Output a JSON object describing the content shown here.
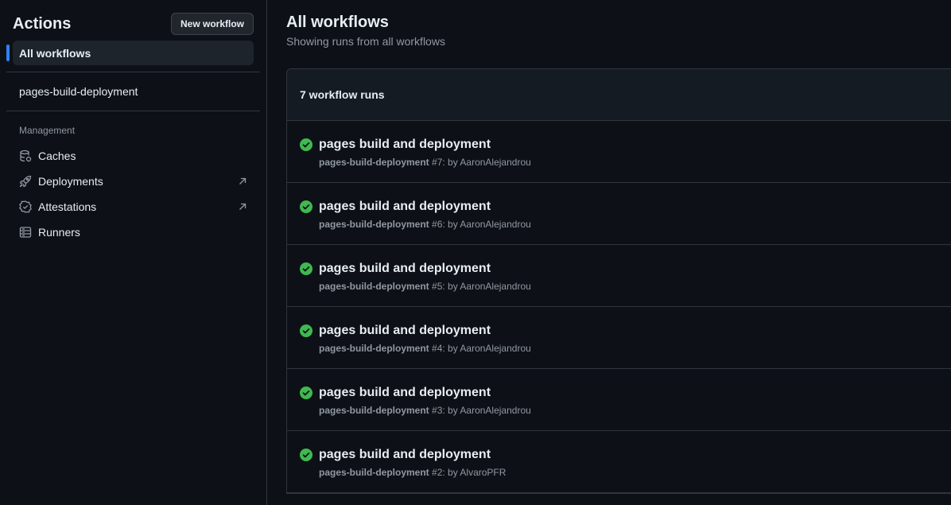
{
  "sidebar": {
    "title": "Actions",
    "new_workflow_label": "New workflow",
    "all_workflows_label": "All workflows",
    "workflows": [
      "pages-build-deployment"
    ],
    "management_label": "Management",
    "management_items": [
      {
        "label": "Caches",
        "icon": "database-icon",
        "external": false
      },
      {
        "label": "Deployments",
        "icon": "rocket-icon",
        "external": true
      },
      {
        "label": "Attestations",
        "icon": "verified-shield-icon",
        "external": true
      },
      {
        "label": "Runners",
        "icon": "server-icon",
        "external": false
      }
    ]
  },
  "main": {
    "title": "All workflows",
    "subtitle": "Showing runs from all workflows",
    "runs_count_label": "7 workflow runs",
    "runs": [
      {
        "title": "pages build and deployment",
        "workflow": "pages-build-deployment",
        "run_number": "#7",
        "by": ": by AaronAlejandrou",
        "status": "success"
      },
      {
        "title": "pages build and deployment",
        "workflow": "pages-build-deployment",
        "run_number": "#6",
        "by": ": by AaronAlejandrou",
        "status": "success"
      },
      {
        "title": "pages build and deployment",
        "workflow": "pages-build-deployment",
        "run_number": "#5",
        "by": ": by AaronAlejandrou",
        "status": "success"
      },
      {
        "title": "pages build and deployment",
        "workflow": "pages-build-deployment",
        "run_number": "#4",
        "by": ": by AaronAlejandrou",
        "status": "success"
      },
      {
        "title": "pages build and deployment",
        "workflow": "pages-build-deployment",
        "run_number": "#3",
        "by": ": by AaronAlejandrou",
        "status": "success"
      },
      {
        "title": "pages build and deployment",
        "workflow": "pages-build-deployment",
        "run_number": "#2",
        "by": ": by AlvaroPFR",
        "status": "success"
      }
    ]
  },
  "colors": {
    "success": "#3fb950",
    "accent": "#2f81f7",
    "background": "#0d1117"
  }
}
